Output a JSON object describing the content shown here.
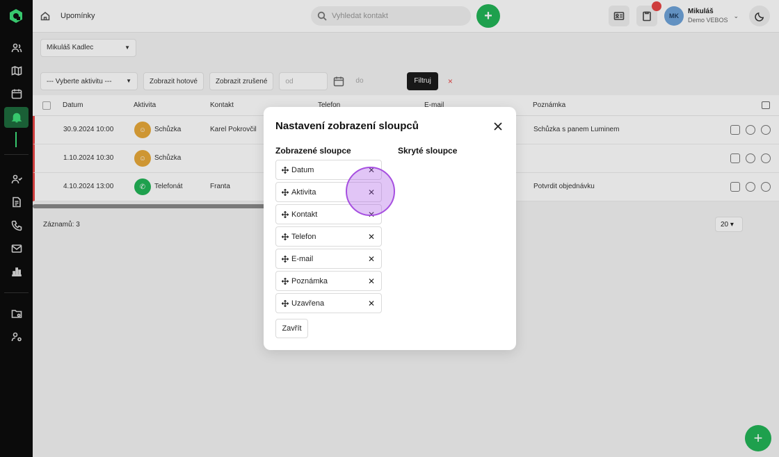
{
  "sidebar": {
    "items": [
      {
        "icon": "users-icon"
      },
      {
        "icon": "map-icon"
      },
      {
        "icon": "calendar-icon"
      },
      {
        "icon": "bell-icon",
        "active": true
      },
      {
        "icon": "user-check-icon"
      },
      {
        "icon": "document-icon"
      },
      {
        "icon": "phone-icon"
      },
      {
        "icon": "mail-icon"
      },
      {
        "icon": "bar-chart-icon"
      },
      {
        "icon": "folder-settings-icon"
      },
      {
        "icon": "user-settings-icon"
      }
    ]
  },
  "topbar": {
    "breadcrumb": "Upomínky",
    "search_placeholder": "Vyhledat kontakt",
    "add_label": "+",
    "user_initials": "MK",
    "user_name": "Mikuláš",
    "user_role": "Demo VEBOS"
  },
  "content": {
    "user_select": "Mikuláš Kadlec",
    "activity_select": "--- Vyberte aktivitu ---",
    "show_done": "Zobrazit hotové",
    "show_closed": "Zobrazit zrušené",
    "date_from": "od",
    "date_to": "do",
    "filter_button": "Filtruj",
    "clear_button": "×",
    "table": {
      "headers": [
        "Datum",
        "Aktivita",
        "Kontakt",
        "Telefon",
        "E-mail",
        "Poznámka"
      ],
      "rows": [
        {
          "date": "30.9.2024 10:00",
          "activity": "Schůzka",
          "contact": "Karel Pokrovčil",
          "note": "Schůzka s panem Luminem",
          "color": "#e8a93a"
        },
        {
          "date": "1.10.2024 10:30",
          "activity": "Schůzka",
          "contact": "",
          "note": "",
          "color": "#e8a93a"
        },
        {
          "date": "4.10.2024 13:00",
          "activity": "Telefonát",
          "contact": "Franta",
          "note": "Potvrdit objednávku",
          "color": "#22b457"
        }
      ]
    },
    "records_label": "Záznamů: 3",
    "page_size": "20"
  },
  "modal": {
    "title": "Nastavení zobrazení sloupců",
    "visible_header": "Zobrazené sloupce",
    "hidden_header": "Skryté sloupce",
    "visible_columns": [
      "Datum",
      "Aktivita",
      "Kontakt",
      "Telefon",
      "E-mail",
      "Poznámka",
      "Uzavřena"
    ],
    "remove_symbol": "✕",
    "close_button": "Zavřít"
  }
}
